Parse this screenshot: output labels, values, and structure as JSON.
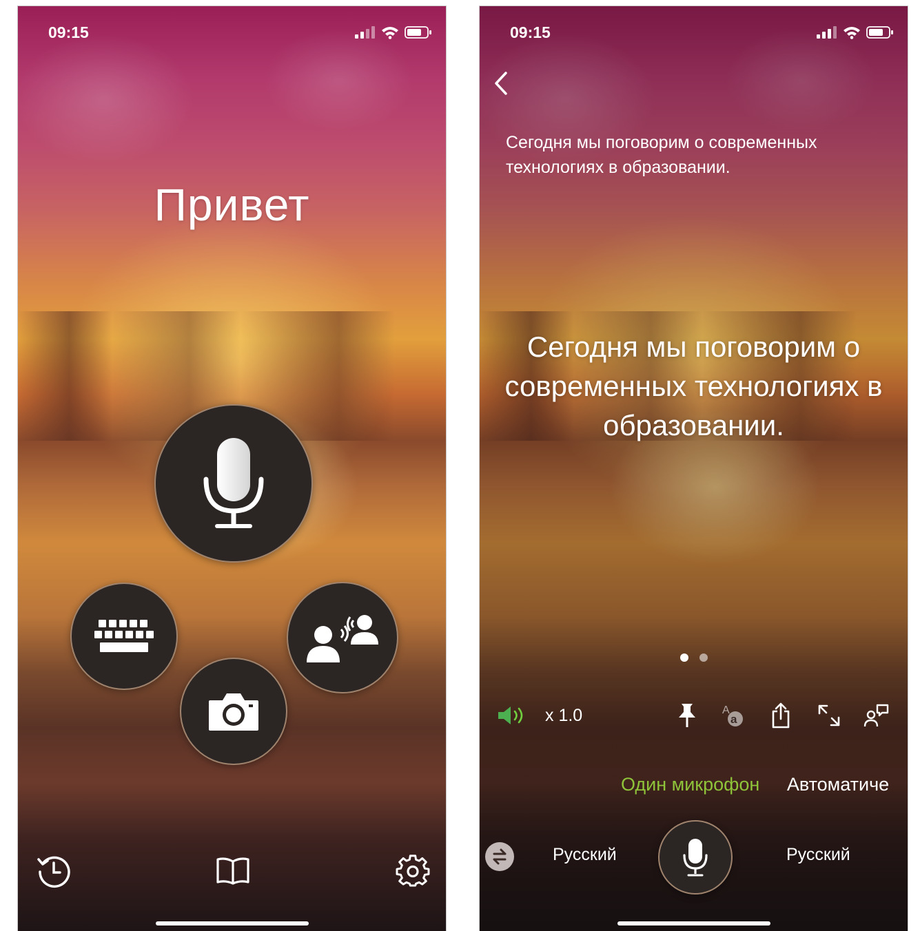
{
  "left_screen": {
    "status_bar": {
      "time": "09:15"
    },
    "greeting": "Привет",
    "buttons": {
      "mic": "microphone-icon",
      "keyboard": "keyboard-icon",
      "camera": "camera-icon",
      "conversation": "conversation-icon"
    },
    "bottom_nav": [
      "history-icon",
      "phrasebook-icon",
      "settings-icon"
    ]
  },
  "right_screen": {
    "status_bar": {
      "time": "09:15"
    },
    "source_text": "Сегодня мы поговорим о современных технологиях в образовании.",
    "translation_text": "Сегодня мы поговорим о современных технологиях в образовании.",
    "page_indicator": {
      "total": 2,
      "current": 1
    },
    "toolbar": {
      "speed": "x 1.0",
      "icons": [
        "speaker-icon",
        "pin-icon",
        "font-translate-icon",
        "share-icon",
        "expand-icon",
        "conversation-icon"
      ]
    },
    "mode_tabs": [
      {
        "label": "Один микрофон",
        "active": true
      },
      {
        "label": "Автоматиче",
        "active": false
      }
    ],
    "languages": {
      "source": "Русский",
      "target": "Русский"
    },
    "colors": {
      "accent_green": "#8ec33a"
    }
  }
}
